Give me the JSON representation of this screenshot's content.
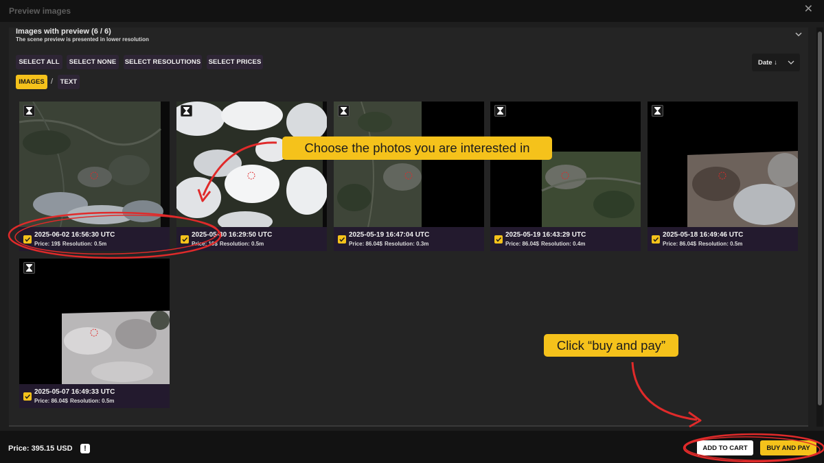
{
  "window": {
    "title": "Preview images",
    "close_label": "✕"
  },
  "section": {
    "title": "Images with preview (6 / 6)",
    "subtitle": "The scene preview is presented in lower resolution"
  },
  "toolbar": {
    "select_all": "SELECT ALL",
    "select_none": "SELECT NONE",
    "select_resolutions": "SELECT RESOLUTIONS",
    "select_prices": "SELECT PRICES",
    "view_images": "IMAGES",
    "separator": "/",
    "view_text": "TEXT",
    "sort_label": "Date ↓"
  },
  "images": [
    {
      "date": "2025-06-02 16:56:30 UTC",
      "price": "Price: 19$",
      "resolution": "Resolution: 0.5m",
      "checked": true
    },
    {
      "date": "2025-05-30 16:29:50 UTC",
      "price": "Price: 19$",
      "resolution": "Resolution: 0.5m",
      "checked": true
    },
    {
      "date": "2025-05-19 16:47:04 UTC",
      "price": "Price: 86.04$",
      "resolution": "Resolution: 0.3m",
      "checked": true
    },
    {
      "date": "2025-05-19 16:43:29 UTC",
      "price": "Price: 86.04$",
      "resolution": "Resolution: 0.4m",
      "checked": true
    },
    {
      "date": "2025-05-18 16:49:46 UTC",
      "price": "Price: 86.04$",
      "resolution": "Resolution: 0.5m",
      "checked": true
    },
    {
      "date": "2025-05-07 16:49:33 UTC",
      "price": "Price: 86.04$",
      "resolution": "Resolution: 0.5m",
      "checked": true
    }
  ],
  "footer": {
    "price": "Price: 395.15 USD",
    "info_icon": "!",
    "add_to_cart": "ADD TO CART",
    "buy_and_pay": "BUY AND PAY"
  },
  "annotations": {
    "callout_choose": "Choose the photos you are interested in",
    "callout_buy": "Click “buy and pay”"
  },
  "colors": {
    "accent": "#f5c21b",
    "annotation_red": "#e02a2a",
    "card_meta_bg": "#231a2e",
    "background": "#1e1e1e"
  },
  "icons": [
    "close-icon",
    "chevron-down-icon",
    "hourglass-icon",
    "checkbox-checked-icon",
    "info-icon"
  ]
}
